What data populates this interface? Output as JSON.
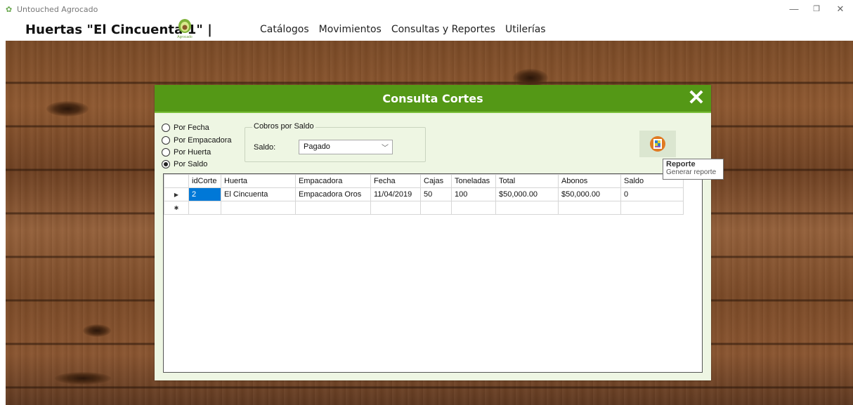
{
  "window": {
    "app_title": "Untouched Agrocado",
    "icons": {
      "app": "avocado-icon",
      "minimize": "minimize-icon",
      "maximize": "maximize-icon",
      "close": "close-icon"
    }
  },
  "header": {
    "brand": "Huertas \"El Cincuenta 1\" |",
    "logo_text": "Agrocado",
    "menu": [
      "Catálogos",
      "Movimientos",
      "Consultas y Reportes",
      "Utilerías"
    ]
  },
  "dialog": {
    "title": "Consulta Cortes",
    "filters": [
      {
        "label": "Por Fecha",
        "checked": false
      },
      {
        "label": "Por Empacadora",
        "checked": false
      },
      {
        "label": "Por Huerta",
        "checked": false
      },
      {
        "label": "Por Saldo",
        "checked": true
      }
    ],
    "group": {
      "legend": "Cobros por Saldo",
      "saldo_label": "Saldo:",
      "saldo_value": "Pagado"
    },
    "report_button": {
      "icon": "report-icon"
    },
    "tooltip": {
      "title": "Reporte",
      "text": "Generar reporte"
    },
    "grid": {
      "columns": [
        "idCorte",
        "Huerta",
        "Empacadora",
        "Fecha",
        "Cajas",
        "Toneladas",
        "Total",
        "Abonos",
        "Saldo"
      ],
      "rows": [
        {
          "marker": "▶",
          "cells": [
            "2",
            "El Cincuenta",
            "Empacadora Oros",
            "11/04/2019",
            "50",
            "100",
            "$50,000.00",
            "$50,000.00",
            "0"
          ]
        },
        {
          "marker": "✱",
          "cells": [
            "",
            "",
            "",
            "",
            "",
            "",
            "",
            "",
            ""
          ]
        }
      ]
    }
  },
  "colors": {
    "header_green": "#549816",
    "dialog_bg": "#eef6e3",
    "selection": "#0078d7"
  }
}
